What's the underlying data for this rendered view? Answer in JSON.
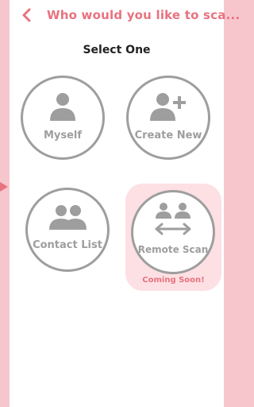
{
  "header": {
    "title": "Who would you like to sca..."
  },
  "subtitle": "Select One",
  "options": {
    "myself": {
      "label": "Myself"
    },
    "create_new": {
      "label": "Create New"
    },
    "contact_list": {
      "label": "Contact List"
    },
    "remote_scan": {
      "label": "Remote Scan",
      "status": "Coming Soon!"
    }
  },
  "colors": {
    "accent": "#e8727f",
    "icon_gray": "#9e9e9e",
    "page_bg": "#f7c6cd",
    "remote_card_bg": "#fde0e4"
  },
  "icons": {
    "back": "chevron-left-icon",
    "myself": "person-icon",
    "create_new": "person-plus-icon",
    "contact_list": "people-group-icon",
    "remote_scan": "two-people-swap-icon"
  }
}
